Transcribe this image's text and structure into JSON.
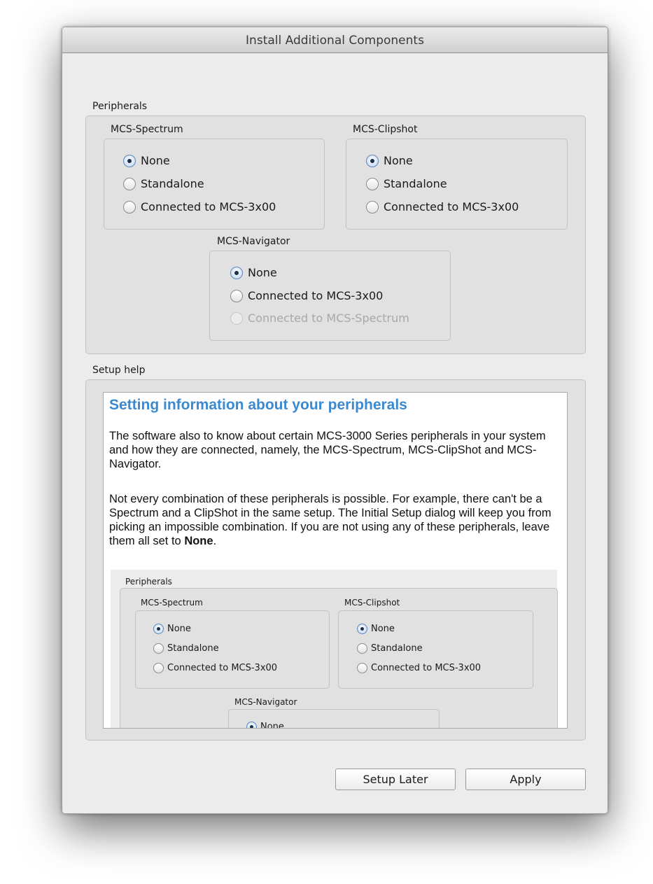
{
  "window": {
    "title": "Install Additional Components"
  },
  "peripherals": {
    "label": "Peripherals",
    "spectrum": {
      "label": "MCS-Spectrum",
      "options": [
        "None",
        "Standalone",
        "Connected to MCS-3x00"
      ],
      "selected": "None"
    },
    "clipshot": {
      "label": "MCS-Clipshot",
      "options": [
        "None",
        "Standalone",
        "Connected to MCS-3x00"
      ],
      "selected": "None"
    },
    "navigator": {
      "label": "MCS-Navigator",
      "options": [
        "None",
        "Connected to MCS-3x00",
        "Connected to MCS-Spectrum"
      ],
      "selected": "None",
      "disabled": [
        "Connected to MCS-Spectrum"
      ]
    }
  },
  "setup_help": {
    "label": "Setup help",
    "heading": "Setting information about your peripherals",
    "para1": "The software also to know about certain MCS-3000 Series peripherals in your system and how they are connected, namely, the MCS-Spectrum, MCS-ClipShot and MCS-Navigator.",
    "para2_pre": "Not every combination of these peripherals is possible. For example, there can't be a Spectrum and a ClipShot in the same setup. The Initial Setup dialog will keep you from picking an impossible combination. If you are not using any of these peripherals, leave them all set to ",
    "para2_bold": "None",
    "para2_post": ".",
    "embedded": {
      "label": "Peripherals",
      "spectrum_label": "MCS-Spectrum",
      "spectrum_options": [
        "None",
        "Standalone",
        "Connected to MCS-3x00"
      ],
      "clipshot_label": "MCS-Clipshot",
      "clipshot_options": [
        "None",
        "Standalone",
        "Connected to MCS-3x00"
      ],
      "navigator_label": "MCS-Navigator",
      "navigator_options": [
        "None"
      ]
    }
  },
  "buttons": {
    "setup_later": "Setup Later",
    "apply": "Apply"
  }
}
